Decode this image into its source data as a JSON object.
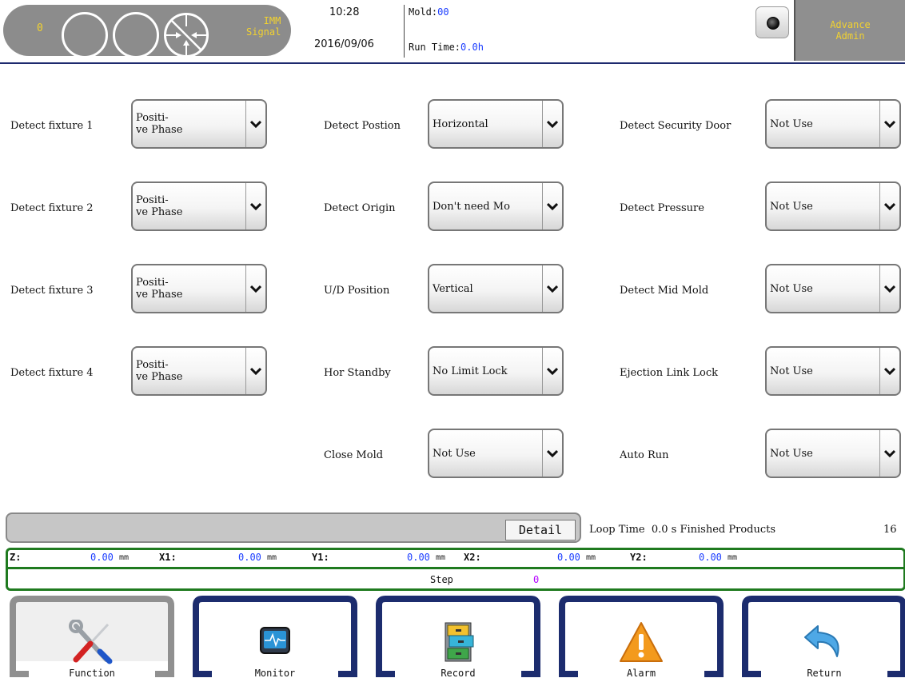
{
  "header": {
    "counter": "0",
    "imm_line1": "IMM",
    "imm_line2": "Signal",
    "time": "10:28",
    "date": "2016/09/06",
    "mold_label": "Mold:",
    "mold_value": "00",
    "runtime_label": "Run Time:",
    "runtime_value": "0.0h",
    "user_line1": "Advance",
    "user_line2": "Admin"
  },
  "settings": {
    "col1": [
      {
        "label": "Detect fixture 1",
        "value": "Positi-\nve Phase"
      },
      {
        "label": "Detect fixture 2",
        "value": "Positi-\nve Phase"
      },
      {
        "label": "Detect fixture 3",
        "value": "Positi-\nve Phase"
      },
      {
        "label": "Detect fixture 4",
        "value": "Positi-\nve Phase"
      }
    ],
    "col2": [
      {
        "label": "Detect Postion",
        "value": "Horizontal"
      },
      {
        "label": "Detect Origin",
        "value": "Don't need Mo"
      },
      {
        "label": "U/D Position",
        "value": "Vertical"
      },
      {
        "label": "Hor Standby",
        "value": "No Limit Lock"
      },
      {
        "label": "Close Mold",
        "value": "Not Use"
      }
    ],
    "col3": [
      {
        "label": "Detect Security Door",
        "value": "Not Use"
      },
      {
        "label": "Detect Pressure",
        "value": "Not Use"
      },
      {
        "label": "Detect Mid Mold",
        "value": "Not Use"
      },
      {
        "label": "Ejection Link Lock",
        "value": "Not Use"
      },
      {
        "label": "Auto Run",
        "value": "Not Use"
      }
    ]
  },
  "detail": {
    "button": "Detail",
    "loop_text": "Loop Time  0.0 s Finished Products",
    "products": "16"
  },
  "axes": [
    {
      "name": "Z:",
      "value": "0.00",
      "unit": "mm"
    },
    {
      "name": "X1:",
      "value": "0.00",
      "unit": "mm"
    },
    {
      "name": "Y1:",
      "value": "0.00",
      "unit": "mm"
    },
    {
      "name": "X2:",
      "value": "0.00",
      "unit": "mm"
    },
    {
      "name": "Y2:",
      "value": "0.00",
      "unit": "mm"
    }
  ],
  "step": {
    "label": "Step",
    "value": "0"
  },
  "nav": [
    {
      "label": "Function",
      "icon": "tools-icon",
      "active": true
    },
    {
      "label": "Monitor",
      "icon": "monitor-icon",
      "active": false
    },
    {
      "label": "Record",
      "icon": "file-cabinet-icon",
      "active": false
    },
    {
      "label": "Alarm",
      "icon": "warning-icon",
      "active": false
    },
    {
      "label": "Return",
      "icon": "return-arrow-icon",
      "active": false
    }
  ],
  "colors": {
    "accent_yellow": "#f2d22f",
    "value_blue": "#1a3cff",
    "step_purple": "#b400ff",
    "frame_navy": "#1c2c6e",
    "frame_grey": "#909090",
    "axis_green": "#1f7a1f"
  }
}
